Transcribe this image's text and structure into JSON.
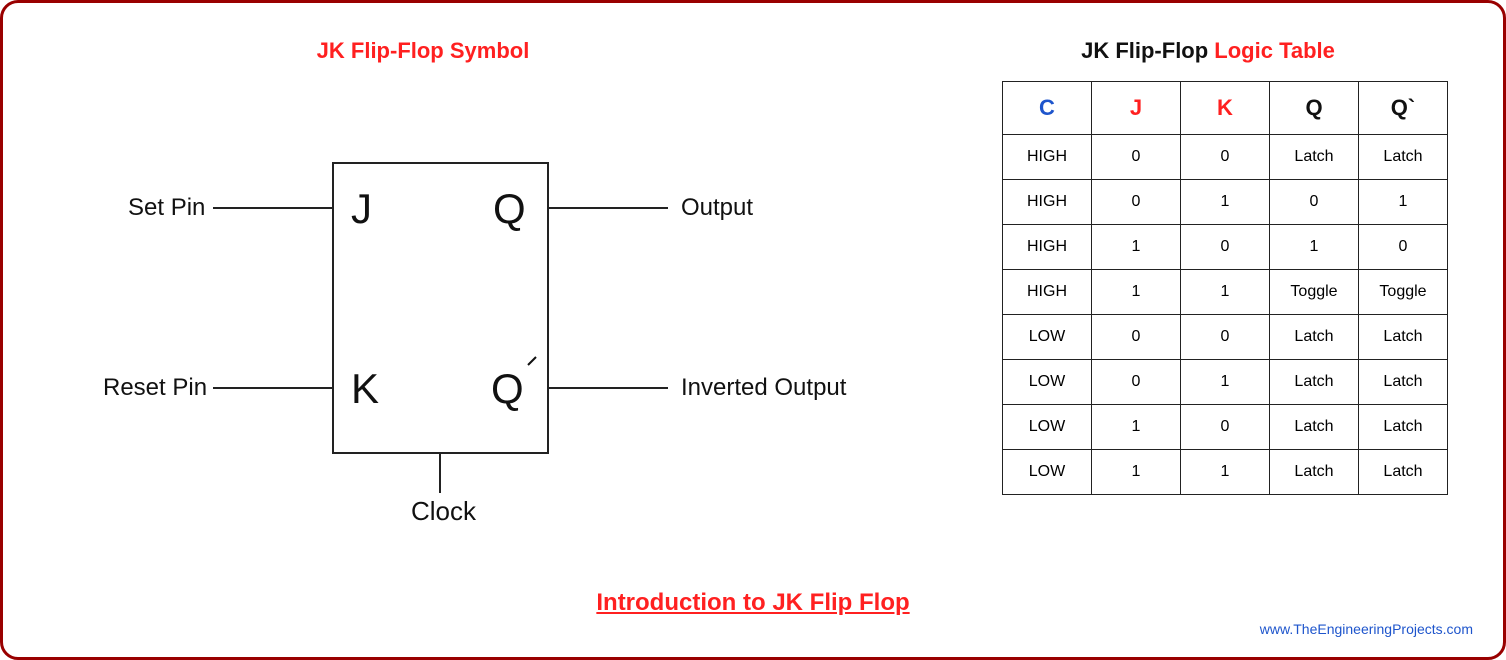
{
  "titles": {
    "symbol": "JK Flip-Flop Symbol",
    "table_plain": "JK Flip-Flop ",
    "table_red": "Logic Table",
    "footer": "Introduction to JK Flip Flop"
  },
  "attribution": "www.TheEngineeringProjects.com",
  "symbol": {
    "set_label": "Set Pin",
    "reset_label": "Reset Pin",
    "output_label": "Output",
    "inv_output_label": "Inverted Output",
    "clock_label": "Clock",
    "j": "J",
    "k": "K",
    "q": "Q",
    "qbar": "Q"
  },
  "table": {
    "headers": {
      "c": "C",
      "j": "J",
      "k": "K",
      "q": "Q",
      "qbar": "Q`"
    },
    "rows": [
      {
        "c": "HIGH",
        "j": "0",
        "k": "0",
        "q": "Latch",
        "qbar": "Latch"
      },
      {
        "c": "HIGH",
        "j": "0",
        "k": "1",
        "q": "0",
        "qbar": "1"
      },
      {
        "c": "HIGH",
        "j": "1",
        "k": "0",
        "q": "1",
        "qbar": "0"
      },
      {
        "c": "HIGH",
        "j": "1",
        "k": "1",
        "q": "Toggle",
        "qbar": "Toggle"
      },
      {
        "c": "LOW",
        "j": "0",
        "k": "0",
        "q": "Latch",
        "qbar": "Latch"
      },
      {
        "c": "LOW",
        "j": "0",
        "k": "1",
        "q": "Latch",
        "qbar": "Latch"
      },
      {
        "c": "LOW",
        "j": "1",
        "k": "0",
        "q": "Latch",
        "qbar": "Latch"
      },
      {
        "c": "LOW",
        "j": "1",
        "k": "1",
        "q": "Latch",
        "qbar": "Latch"
      }
    ]
  }
}
